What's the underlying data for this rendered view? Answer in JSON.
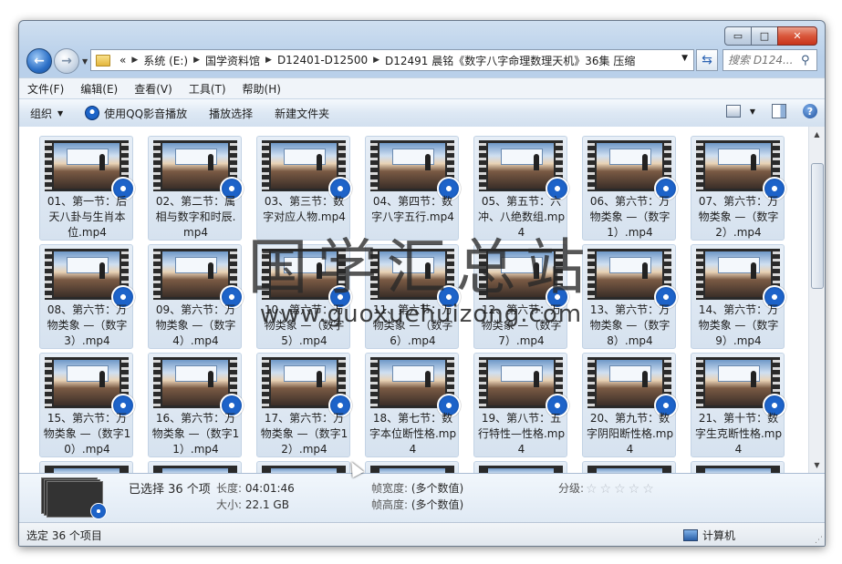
{
  "window": {
    "minimize_glyph": "▭",
    "maximize_glyph": "□",
    "close_glyph": "✕"
  },
  "address": {
    "overflow": "«",
    "parts": [
      "系统 (E:)",
      "国学资料馆",
      "D12401-D12500",
      "D12491 晨铭《数字八字命理数理天机》36集 压缩"
    ]
  },
  "search": {
    "placeholder": "搜索 D124..."
  },
  "menu": [
    "文件(F)",
    "编辑(E)",
    "查看(V)",
    "工具(T)",
    "帮助(H)"
  ],
  "toolbar": {
    "organize": "组织",
    "play_qq": "使用QQ影音播放",
    "play_selection": "播放选择",
    "new_folder": "新建文件夹"
  },
  "files": [
    "01、第一节：后天八卦与生肖本位.mp4",
    "02、第二节：属相与数字和时辰.mp4",
    "03、第三节：数字对应人物.mp4",
    "04、第四节：数字八字五行.mp4",
    "05、第五节：六冲、八绝数组.mp4",
    "06、第六节：万物类象 —（数字1）.mp4",
    "07、第六节：万物类象 —（数字2）.mp4",
    "08、第六节：万物类象 —（数字3）.mp4",
    "09、第六节：万物类象 —（数字4）.mp4",
    "10、第六节：万物类象 —（数字5）.mp4",
    "11、第六节：万物类象 —（数字6）.mp4",
    "12、第六节：万物类象 —（数字7）.mp4",
    "13、第六节：万物类象 —（数字8）.mp4",
    "14、第六节：万物类象 —（数字9）.mp4",
    "15、第六节：万物类象 —（数字10）.mp4",
    "16、第六节：万物类象 —（数字11）.mp4",
    "17、第六节：万物类象 —（数字12）.mp4",
    "18、第七节：数字本位断性格.mp4",
    "19、第八节：五行特性—性格.mp4",
    "20、第九节：数字阴阳断性格.mp4",
    "21、第十节：数字生克断性格.mp4"
  ],
  "watermark": {
    "cn": "国学汇总站",
    "en": "www.guoxuehuizong.com"
  },
  "details": {
    "selected": "已选择 36 个项",
    "length_label": "长度:",
    "length_value": "04:01:46",
    "size_label": "大小:",
    "size_value": "22.1 GB",
    "frame_width_label": "帧宽度:",
    "frame_width_value": "(多个数值)",
    "frame_height_label": "帧高度:",
    "frame_height_value": "(多个数值)",
    "rating_label": "分级:",
    "rating_stars": "☆☆☆☆☆"
  },
  "status": {
    "left": "选定 36 个项目",
    "right": "计算机"
  }
}
